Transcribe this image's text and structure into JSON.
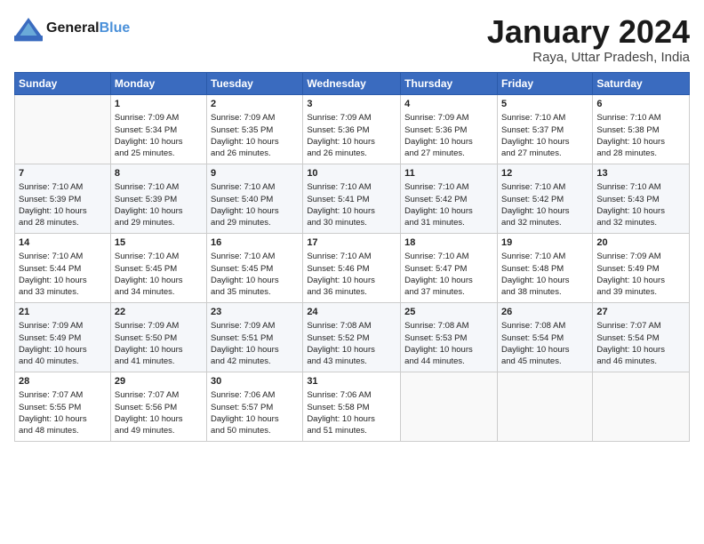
{
  "header": {
    "logo_line1": "General",
    "logo_line2": "Blue",
    "title": "January 2024",
    "subtitle": "Raya, Uttar Pradesh, India"
  },
  "weekdays": [
    "Sunday",
    "Monday",
    "Tuesday",
    "Wednesday",
    "Thursday",
    "Friday",
    "Saturday"
  ],
  "weeks": [
    [
      {
        "day": "",
        "info": ""
      },
      {
        "day": "1",
        "info": "Sunrise: 7:09 AM\nSunset: 5:34 PM\nDaylight: 10 hours\nand 25 minutes."
      },
      {
        "day": "2",
        "info": "Sunrise: 7:09 AM\nSunset: 5:35 PM\nDaylight: 10 hours\nand 26 minutes."
      },
      {
        "day": "3",
        "info": "Sunrise: 7:09 AM\nSunset: 5:36 PM\nDaylight: 10 hours\nand 26 minutes."
      },
      {
        "day": "4",
        "info": "Sunrise: 7:09 AM\nSunset: 5:36 PM\nDaylight: 10 hours\nand 27 minutes."
      },
      {
        "day": "5",
        "info": "Sunrise: 7:10 AM\nSunset: 5:37 PM\nDaylight: 10 hours\nand 27 minutes."
      },
      {
        "day": "6",
        "info": "Sunrise: 7:10 AM\nSunset: 5:38 PM\nDaylight: 10 hours\nand 28 minutes."
      }
    ],
    [
      {
        "day": "7",
        "info": "Sunrise: 7:10 AM\nSunset: 5:39 PM\nDaylight: 10 hours\nand 28 minutes."
      },
      {
        "day": "8",
        "info": "Sunrise: 7:10 AM\nSunset: 5:39 PM\nDaylight: 10 hours\nand 29 minutes."
      },
      {
        "day": "9",
        "info": "Sunrise: 7:10 AM\nSunset: 5:40 PM\nDaylight: 10 hours\nand 29 minutes."
      },
      {
        "day": "10",
        "info": "Sunrise: 7:10 AM\nSunset: 5:41 PM\nDaylight: 10 hours\nand 30 minutes."
      },
      {
        "day": "11",
        "info": "Sunrise: 7:10 AM\nSunset: 5:42 PM\nDaylight: 10 hours\nand 31 minutes."
      },
      {
        "day": "12",
        "info": "Sunrise: 7:10 AM\nSunset: 5:42 PM\nDaylight: 10 hours\nand 32 minutes."
      },
      {
        "day": "13",
        "info": "Sunrise: 7:10 AM\nSunset: 5:43 PM\nDaylight: 10 hours\nand 32 minutes."
      }
    ],
    [
      {
        "day": "14",
        "info": "Sunrise: 7:10 AM\nSunset: 5:44 PM\nDaylight: 10 hours\nand 33 minutes."
      },
      {
        "day": "15",
        "info": "Sunrise: 7:10 AM\nSunset: 5:45 PM\nDaylight: 10 hours\nand 34 minutes."
      },
      {
        "day": "16",
        "info": "Sunrise: 7:10 AM\nSunset: 5:45 PM\nDaylight: 10 hours\nand 35 minutes."
      },
      {
        "day": "17",
        "info": "Sunrise: 7:10 AM\nSunset: 5:46 PM\nDaylight: 10 hours\nand 36 minutes."
      },
      {
        "day": "18",
        "info": "Sunrise: 7:10 AM\nSunset: 5:47 PM\nDaylight: 10 hours\nand 37 minutes."
      },
      {
        "day": "19",
        "info": "Sunrise: 7:10 AM\nSunset: 5:48 PM\nDaylight: 10 hours\nand 38 minutes."
      },
      {
        "day": "20",
        "info": "Sunrise: 7:09 AM\nSunset: 5:49 PM\nDaylight: 10 hours\nand 39 minutes."
      }
    ],
    [
      {
        "day": "21",
        "info": "Sunrise: 7:09 AM\nSunset: 5:49 PM\nDaylight: 10 hours\nand 40 minutes."
      },
      {
        "day": "22",
        "info": "Sunrise: 7:09 AM\nSunset: 5:50 PM\nDaylight: 10 hours\nand 41 minutes."
      },
      {
        "day": "23",
        "info": "Sunrise: 7:09 AM\nSunset: 5:51 PM\nDaylight: 10 hours\nand 42 minutes."
      },
      {
        "day": "24",
        "info": "Sunrise: 7:08 AM\nSunset: 5:52 PM\nDaylight: 10 hours\nand 43 minutes."
      },
      {
        "day": "25",
        "info": "Sunrise: 7:08 AM\nSunset: 5:53 PM\nDaylight: 10 hours\nand 44 minutes."
      },
      {
        "day": "26",
        "info": "Sunrise: 7:08 AM\nSunset: 5:54 PM\nDaylight: 10 hours\nand 45 minutes."
      },
      {
        "day": "27",
        "info": "Sunrise: 7:07 AM\nSunset: 5:54 PM\nDaylight: 10 hours\nand 46 minutes."
      }
    ],
    [
      {
        "day": "28",
        "info": "Sunrise: 7:07 AM\nSunset: 5:55 PM\nDaylight: 10 hours\nand 48 minutes."
      },
      {
        "day": "29",
        "info": "Sunrise: 7:07 AM\nSunset: 5:56 PM\nDaylight: 10 hours\nand 49 minutes."
      },
      {
        "day": "30",
        "info": "Sunrise: 7:06 AM\nSunset: 5:57 PM\nDaylight: 10 hours\nand 50 minutes."
      },
      {
        "day": "31",
        "info": "Sunrise: 7:06 AM\nSunset: 5:58 PM\nDaylight: 10 hours\nand 51 minutes."
      },
      {
        "day": "",
        "info": ""
      },
      {
        "day": "",
        "info": ""
      },
      {
        "day": "",
        "info": ""
      }
    ]
  ]
}
